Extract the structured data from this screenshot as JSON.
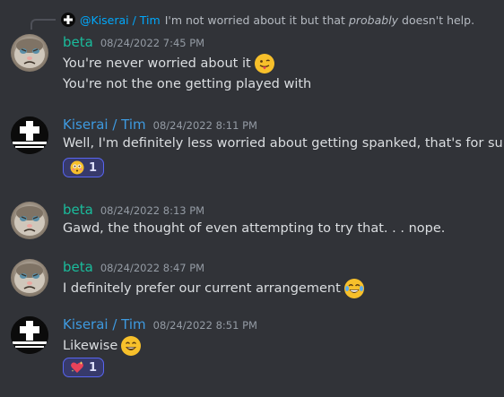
{
  "reply": {
    "author": "@Kiserai / Tim",
    "text_plain": "I'm not worried about it but that",
    "text_italic": "probably",
    "text_end": "doesn't help."
  },
  "messages": [
    {
      "author": "beta",
      "timestamp": "08/24/2022 7:45 PM",
      "avatar_icon": "grumpy-cat-avatar",
      "lines": [
        "You're never worried about it",
        "You're not the one getting played with"
      ]
    },
    {
      "author": "Kiserai / Tim",
      "timestamp": "08/24/2022 8:11 PM",
      "avatar_icon": "cross-avatar",
      "lines": [
        "Well, I'm definitely less worried about getting spanked, that's for sure"
      ],
      "reaction": {
        "emoji": "flushed-face",
        "count": "1"
      }
    },
    {
      "author": "beta",
      "timestamp": "08/24/2022 8:13 PM",
      "avatar_icon": "grumpy-cat-avatar",
      "lines": [
        "Gawd, the thought of even attempting to try that. . . nope."
      ]
    },
    {
      "author": "beta",
      "timestamp": "08/24/2022 8:47 PM",
      "avatar_icon": "grumpy-cat-avatar",
      "lines": [
        "I definitely prefer our current arrangement"
      ]
    },
    {
      "author": "Kiserai / Tim",
      "timestamp": "08/24/2022 8:51 PM",
      "avatar_icon": "cross-avatar",
      "lines": [
        "Likewise"
      ],
      "reaction": {
        "emoji": "sparkling-heart",
        "count": "1"
      }
    }
  ],
  "colors": {
    "background": "#313338",
    "beta_name": "#1abc9c",
    "kiserai_name": "#3e9ae0",
    "reaction_border": "#5865f2"
  }
}
